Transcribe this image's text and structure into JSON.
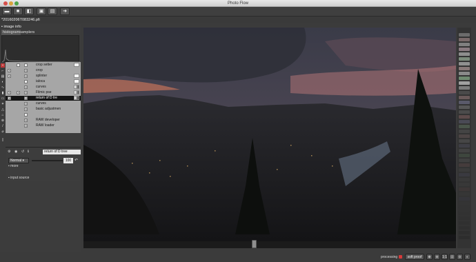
{
  "window": {
    "title": "Photo Flow"
  },
  "toolbar": {
    "buttons": [
      {
        "name": "open-folder-icon",
        "glyph": "▬"
      },
      {
        "name": "save-icon",
        "glyph": "■"
      },
      {
        "name": "save-as-icon",
        "glyph": "◧"
      },
      {
        "name": "export-icon",
        "glyph": "▣"
      },
      {
        "name": "export-image-icon",
        "glyph": "▤"
      },
      {
        "name": "exit-icon",
        "glyph": "➜"
      }
    ]
  },
  "file_tab": {
    "label": "*20160206T083246.pfi"
  },
  "left_panel": {
    "image_info": "image info",
    "tabs": {
      "histogram": "histogram",
      "samplers": "samplers"
    },
    "layers": [
      {
        "label": "crop setter",
        "selected": false
      },
      {
        "label": "crop",
        "selected": false
      },
      {
        "label": "splinter",
        "selected": false
      },
      {
        "label": "ialoca",
        "selected": false
      },
      {
        "label": "curves",
        "selected": false
      },
      {
        "label": "Filmic pse",
        "selected": false
      },
      {
        "label": "return of D tre",
        "selected": true
      },
      {
        "label": "curves",
        "selected": false
      },
      {
        "label": "basic adjustmen",
        "selected": false
      },
      {
        "label": "",
        "selected": false
      },
      {
        "label": "RAW developer",
        "selected": false
      },
      {
        "label": "RAW loader",
        "selected": false
      }
    ],
    "controls": {
      "layer_name": "return of D tree",
      "blend_mode": "Normal",
      "opacity": "100",
      "more": "more",
      "input_source": "input source"
    }
  },
  "statusbar": {
    "processing": "processing",
    "soft_proof": "soft proof",
    "zoom_buttons": [
      "⊕",
      "⊖",
      "1:1",
      "⊡",
      "⊙",
      "◐"
    ]
  },
  "colors": {
    "processing_indicator": "#d63a3a",
    "layer_panel_bg": "#a6a6a6",
    "selected_row": "#151515"
  }
}
